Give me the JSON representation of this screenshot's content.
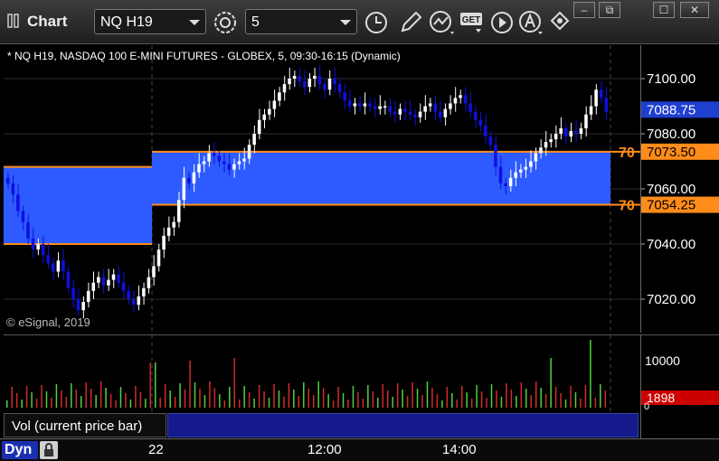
{
  "window": {
    "title": "Chart",
    "minimize_label": "–",
    "restore_label": "⧉",
    "maximize_label": "☐",
    "close_label": "✕"
  },
  "toolbar": {
    "symbol_value": "NQ H19",
    "interval_value": "5",
    "icons": [
      "settings-icon",
      "clock-icon",
      "pencil-icon",
      "chart-style-icon",
      "get-data-icon",
      "play-icon",
      "alert-icon",
      "link-icon"
    ],
    "get_label": "GET"
  },
  "chart": {
    "description": "* NQ H19, NASDAQ 100 E-MINI FUTURES - GLOBEX, 5, 09:30-16:15 (Dynamic)",
    "watermark": "© eSignal, 2019",
    "price_ticks": [
      "7100.00",
      "7080.00",
      "7060.00",
      "7040.00",
      "7020.00"
    ],
    "current_price_label": "7088.75",
    "zone_upper_label": "7073.50",
    "zone_lower_label": "7054.25",
    "zone_upper_short": "70",
    "zone_lower_short": "70",
    "colors": {
      "up_candle": "#ffffff",
      "down_candle": "#1010e0",
      "zone_fill": "#2d5bff",
      "zone_line": "#ff8c1a",
      "vol_up": "#4fd23c",
      "vol_down": "#d42a2a",
      "current_price_bg": "#1f3fd0",
      "vol_label_bg": "#cc0000"
    }
  },
  "volume": {
    "tick_label": "10000",
    "zero_label": "0",
    "current_label": "1898",
    "legend_label": "Vol (current price bar)",
    "close_label": "×"
  },
  "time_axis": {
    "labels": [
      "22",
      "12:00",
      "14:00"
    ],
    "mode_label": "Dyn"
  }
}
